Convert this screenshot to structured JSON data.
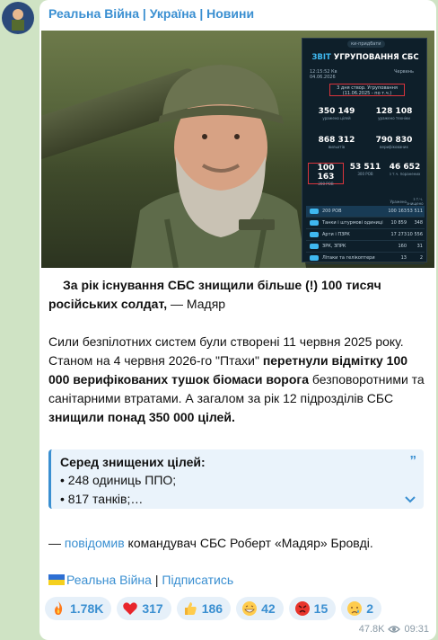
{
  "channel": {
    "name": "Реальна Війна | Україна | Новини"
  },
  "report": {
    "badge": "ки-придбати",
    "title_prefix": "ЗВІТ",
    "title_main": "УГРУПОВАННЯ СБС",
    "time": "12:15:52 Кв",
    "date": "04.06.2026",
    "month": "Червень",
    "note_line1": "3 дня створ. Угруповання",
    "note_line2": "(11.06.2025 - по т.ч.)",
    "stats": [
      {
        "value": "350 149",
        "label": "уражено цілей"
      },
      {
        "value": "128 108",
        "label": "уражено техніки"
      },
      {
        "value": "868 312",
        "label": "вильотів"
      },
      {
        "value": "790 830",
        "label": "верифікованих"
      },
      {
        "value": "100 163",
        "label": "200 РОВ"
      },
      {
        "value": "53 511",
        "label": "300 РОВ"
      },
      {
        "value": "46 652",
        "label": "з т.ч. поранених"
      }
    ],
    "rows_header": {
      "a": "Уражено",
      "b": "з т.ч. знищено"
    },
    "rows": [
      {
        "name": "200 РОВ",
        "a": "100 163",
        "b": "53 511"
      },
      {
        "name": "Танки і штурмові одиниці",
        "a": "10 859",
        "b": "348"
      },
      {
        "name": "Арти і ПЗРК",
        "a": "17 273",
        "b": "10 556"
      },
      {
        "name": "ЗРК, ЗПРК",
        "a": "160",
        "b": "31"
      },
      {
        "name": "Літаки та гелікоптери",
        "a": "13",
        "b": "2"
      }
    ]
  },
  "post": {
    "lead_bold": "За рік існування СБС знищили більше (!) 100 тисяч російських солдат,",
    "lead_author": " — Мадяр",
    "p2_a": "Сили безпілотних систем були створені 11 червня 2025 року. Станом на 4 червня 2026-го \"Птахи\" ",
    "p2_b": "перетнули відмітку 100 000 верифікованих тушок біомаси ворога",
    "p2_c": " безповоротними та санітарними втратами. А загалом за рік 12 підрозділів СБС ",
    "p2_d": "знищили понад 350 000 цілей.",
    "quote_title": "Серед знищених цілей:",
    "quote_line1": "• 248 одиниць ППО;",
    "quote_line2": "• 817 танків;…",
    "src_dash": "— ",
    "src_link": "повідомив",
    "src_rest": " командувач СБС Роберт «Мадяр» Бровді.",
    "sig_channel": "Реальна Війна",
    "sig_sep": " | ",
    "sig_sub": "Підписатись"
  },
  "reactions": [
    {
      "icon": "fire",
      "count": "1.78K"
    },
    {
      "icon": "heart",
      "count": "317"
    },
    {
      "icon": "thumbs-up",
      "count": "186"
    },
    {
      "icon": "grin",
      "count": "42"
    },
    {
      "icon": "angry",
      "count": "15"
    },
    {
      "icon": "crying",
      "count": "2"
    }
  ],
  "footer": {
    "views": "47.8K",
    "time": "09:31"
  }
}
